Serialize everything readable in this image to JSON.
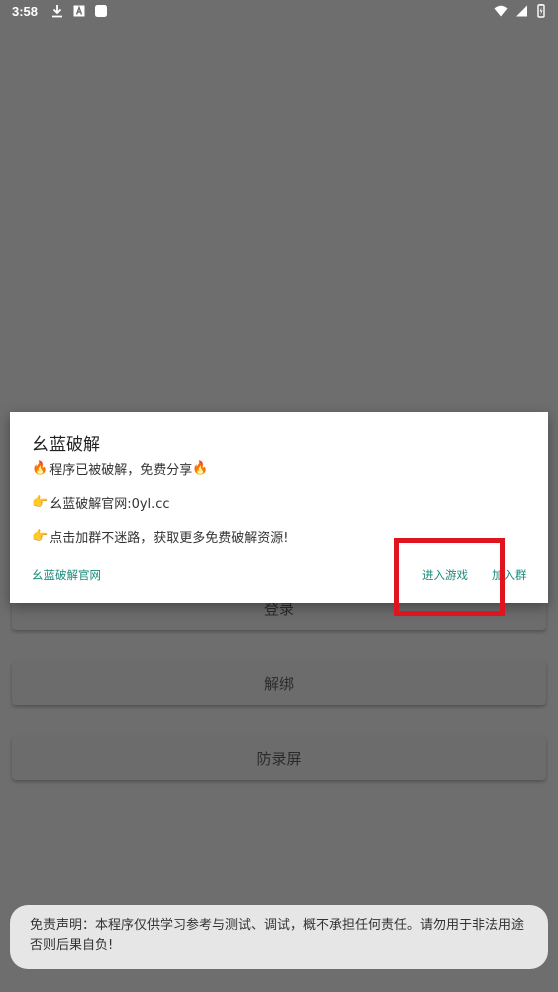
{
  "status_bar": {
    "time": "3:58",
    "left_icons": [
      "download-icon",
      "font-app-icon",
      "app-square-icon"
    ],
    "right_icons": [
      "wifi-icon",
      "signal-icon",
      "battery-icon"
    ]
  },
  "background_buttons": {
    "login_label": "登录",
    "unbind_label": "解绑",
    "anti_record_label": "防录屏"
  },
  "dialog": {
    "title": "幺蓝破解",
    "line1_prefix": "🔥",
    "line1_text": "程序已被破解，免费分享",
    "line1_suffix": "🔥",
    "line2_prefix": "👉",
    "line2_text": "幺蓝破解官网:0yl.cc",
    "line3_prefix": "👉",
    "line3_text": "点击加群不迷路，获取更多免费破解资源!",
    "action_site": "幺蓝破解官网",
    "action_enter_game": "进入游戏",
    "action_join_group": "加入群"
  },
  "toast": {
    "text": "免责声明：本程序仅供学习参考与测试、调试，概不承担任何责任。请勿用于非法用途否则后果自负!"
  },
  "colors": {
    "overlay": "#6e6e6e",
    "dialog_bg": "#ffffff",
    "accent_teal": "#1a8a7a",
    "highlight_red": "#e0141e",
    "toast_bg": "#e6e6e6"
  }
}
